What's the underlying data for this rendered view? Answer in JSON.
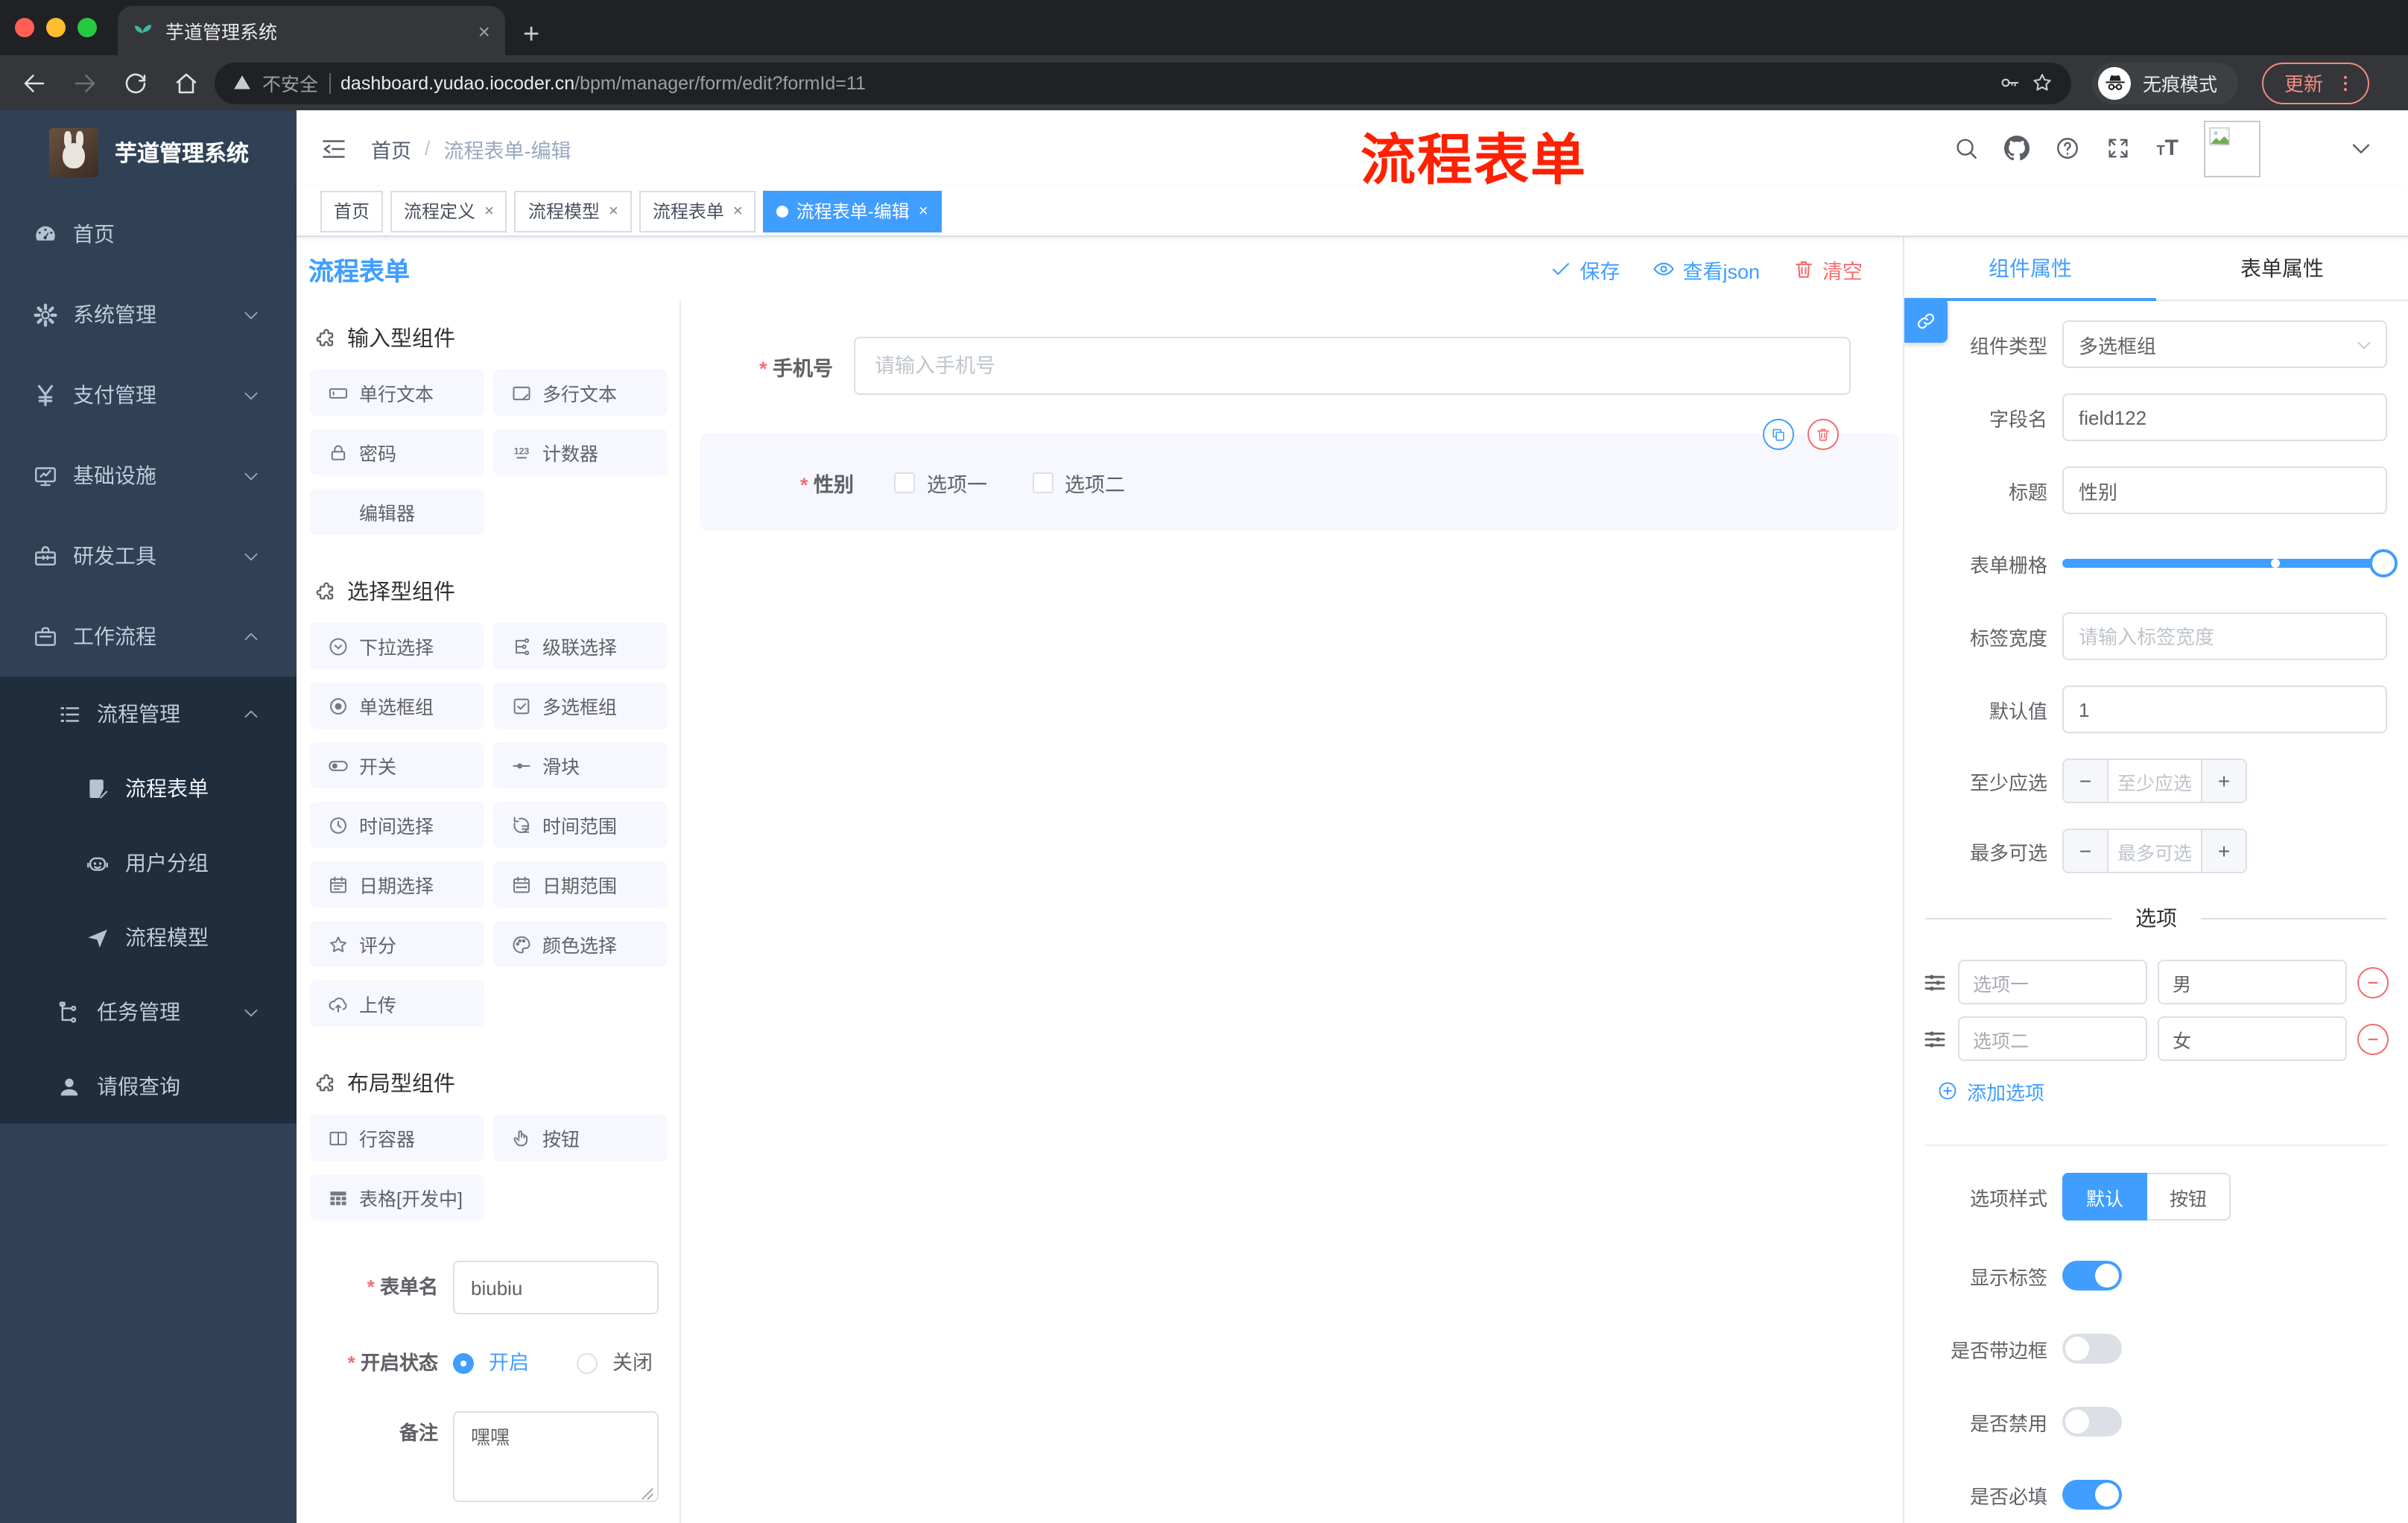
{
  "browser": {
    "tab_title": "芋道管理系统",
    "security_label": "不安全",
    "url_host": "dashboard.yudao.iocoder.cn",
    "url_path": "/bpm/manager/form/edit?formId=11",
    "incognito_label": "无痕模式",
    "update_label": "更新"
  },
  "sidebar": {
    "app_title": "芋道管理系统",
    "menu": [
      {
        "label": "首页",
        "icon": "dashboard",
        "level": 1
      },
      {
        "label": "系统管理",
        "icon": "gear",
        "level": 1,
        "chevron": "down"
      },
      {
        "label": "支付管理",
        "icon": "yen",
        "level": 1,
        "chevron": "down"
      },
      {
        "label": "基础设施",
        "icon": "monitor",
        "level": 1,
        "chevron": "down"
      },
      {
        "label": "研发工具",
        "icon": "toolbox",
        "level": 1,
        "chevron": "down"
      },
      {
        "label": "工作流程",
        "icon": "briefcase",
        "level": 1,
        "chevron": "up"
      },
      {
        "label": "流程管理",
        "icon": "list",
        "level": 2,
        "chevron": "up"
      },
      {
        "label": "流程表单",
        "icon": "form-doc",
        "level": 3,
        "active": true
      },
      {
        "label": "用户分组",
        "icon": "robot",
        "level": 3
      },
      {
        "label": "流程模型",
        "icon": "paper-plane",
        "level": 3
      },
      {
        "label": "任务管理",
        "icon": "tree",
        "level": 2,
        "chevron": "down"
      },
      {
        "label": "请假查询",
        "icon": "user",
        "level": 2
      }
    ]
  },
  "header": {
    "breadcrumb_home": "首页",
    "breadcrumb_current": "流程表单-编辑",
    "annotation": "流程表单"
  },
  "tags": [
    {
      "label": "首页",
      "closable": false,
      "active": false
    },
    {
      "label": "流程定义",
      "closable": true,
      "active": false
    },
    {
      "label": "流程模型",
      "closable": true,
      "active": false
    },
    {
      "label": "流程表单",
      "closable": true,
      "active": false
    },
    {
      "label": "流程表单-编辑",
      "closable": true,
      "active": true
    }
  ],
  "designer": {
    "title": "流程表单",
    "actions": {
      "save": "保存",
      "view_json": "查看json",
      "clear": "清空"
    },
    "sections": [
      {
        "title": "输入型组件",
        "items": [
          {
            "label": "单行文本",
            "icon": "input"
          },
          {
            "label": "多行文本",
            "icon": "textarea"
          },
          {
            "label": "密码",
            "icon": "lock"
          },
          {
            "label": "计数器",
            "icon": "counter"
          },
          {
            "label": "编辑器",
            "icon": null
          }
        ]
      },
      {
        "title": "选择型组件",
        "items": [
          {
            "label": "下拉选择",
            "icon": "select"
          },
          {
            "label": "级联选择",
            "icon": "cascader"
          },
          {
            "label": "单选框组",
            "icon": "radio"
          },
          {
            "label": "多选框组",
            "icon": "checkbox"
          },
          {
            "label": "开关",
            "icon": "switch"
          },
          {
            "label": "滑块",
            "icon": "slider"
          },
          {
            "label": "时间选择",
            "icon": "time"
          },
          {
            "label": "时间范围",
            "icon": "time-range"
          },
          {
            "label": "日期选择",
            "icon": "date"
          },
          {
            "label": "日期范围",
            "icon": "date-range"
          },
          {
            "label": "评分",
            "icon": "star"
          },
          {
            "label": "颜色选择",
            "icon": "palette"
          },
          {
            "label": "上传",
            "icon": "upload"
          }
        ]
      },
      {
        "title": "布局型组件",
        "items": [
          {
            "label": "行容器",
            "icon": "row"
          },
          {
            "label": "按钮",
            "icon": "button"
          },
          {
            "label": "表格[开发中]",
            "icon": "table"
          }
        ]
      }
    ],
    "form": {
      "name_label": "表单名",
      "name_value": "biubiu",
      "status_label": "开启状态",
      "status_on": "开启",
      "status_off": "关闭",
      "remark_label": "备注",
      "remark_value": "嘿嘿"
    },
    "canvas": {
      "phone_label": "手机号",
      "phone_placeholder": "请输入手机号",
      "gender_label": "性别",
      "gender_options": [
        "选项一",
        "选项二"
      ]
    }
  },
  "properties": {
    "tab_component": "组件属性",
    "tab_form": "表单属性",
    "component_type_label": "组件类型",
    "component_type_value": "多选框组",
    "field_name_label": "字段名",
    "field_name_value": "field122",
    "title_label": "标题",
    "title_value": "性别",
    "grid_label": "表单栅格",
    "label_width_label": "标签宽度",
    "label_width_placeholder": "请输入标签宽度",
    "default_label": "默认值",
    "default_value": "1",
    "min_label": "至少应选",
    "min_placeholder": "至少应选",
    "max_label": "最多可选",
    "max_placeholder": "最多可选",
    "options_title": "选项",
    "options": [
      {
        "label": "选项一",
        "value": "男"
      },
      {
        "label": "选项二",
        "value": "女"
      }
    ],
    "add_option": "添加选项",
    "style_label": "选项样式",
    "style_default": "默认",
    "style_button": "按钮",
    "switches": [
      {
        "label": "显示标签",
        "on": true
      },
      {
        "label": "是否带边框",
        "on": false
      },
      {
        "label": "是否禁用",
        "on": false
      },
      {
        "label": "是否必填",
        "on": true
      }
    ]
  },
  "colors": {
    "accent": "#409eff",
    "danger": "#f56c6c",
    "annotation": "#ff2000",
    "sidebar_bg": "#304156",
    "submenu_bg": "#1f2d3d"
  }
}
